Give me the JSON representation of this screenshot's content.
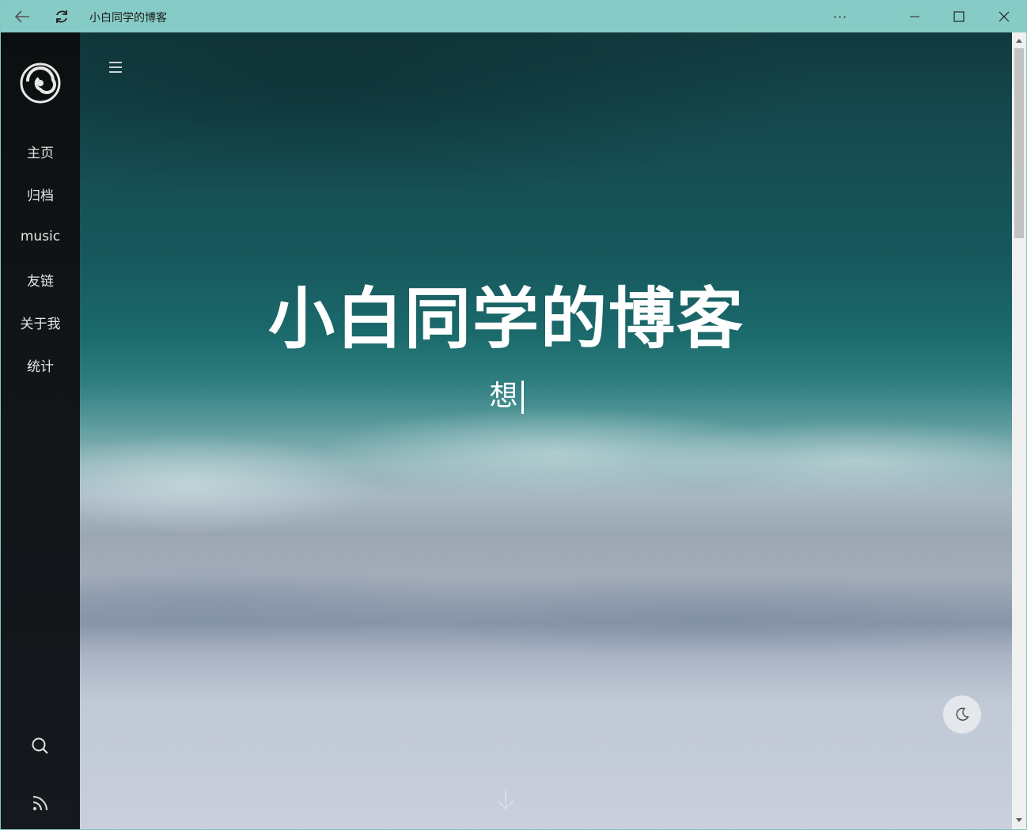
{
  "window": {
    "title": "小白同学的博客",
    "titlebar_color": "#86cbc5",
    "icons": [
      "back-arrow-icon",
      "refresh-icon",
      "more-icon",
      "minimize-icon",
      "maximize-icon",
      "close-icon"
    ],
    "more_label": "···"
  },
  "sidebar": {
    "logo": "swirl-logo",
    "items": [
      {
        "label": "主页"
      },
      {
        "label": "归档"
      },
      {
        "label": "music"
      },
      {
        "label": "友链"
      },
      {
        "label": "关于我"
      },
      {
        "label": "统计"
      }
    ],
    "bottom_icons": [
      "search-icon",
      "rss-icon"
    ]
  },
  "hero": {
    "title": "小白同学的博客",
    "subtitle": "想",
    "menu_icon": "hamburger-menu-icon",
    "darkmode_icon": "moon-icon",
    "scroll_icon": "arrow-down-icon"
  }
}
